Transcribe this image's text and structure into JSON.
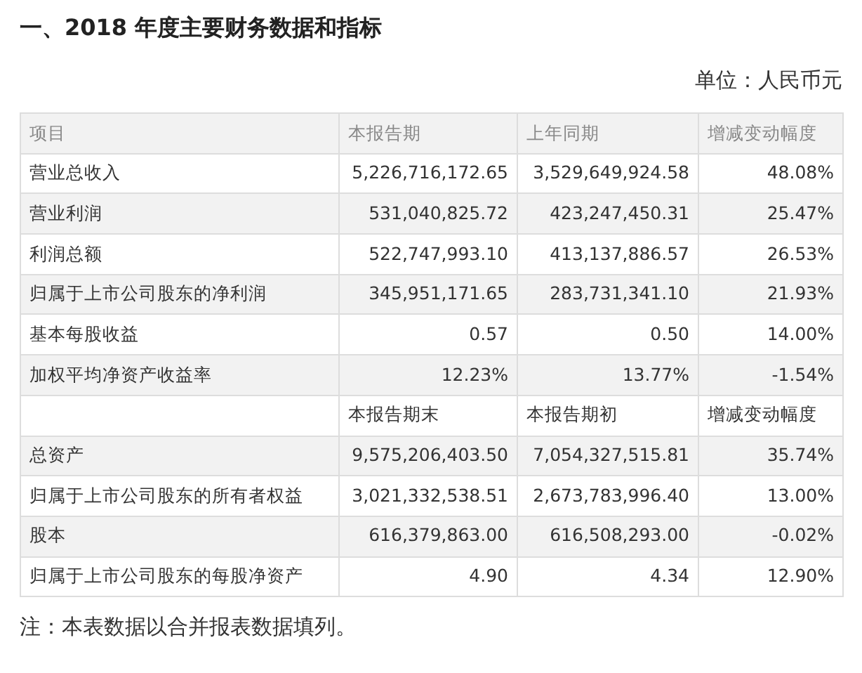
{
  "title": "一、2018 年度主要财务数据和指标",
  "unit": "单位：人民币元",
  "table": {
    "rows": [
      {
        "kind": "header",
        "cells": [
          "项目",
          "本报告期",
          "上年同期",
          "增减变动幅度"
        ]
      },
      {
        "kind": "data",
        "cells": [
          "营业总收入",
          "5,226,716,172.65",
          "3,529,649,924.58",
          "48.08%"
        ]
      },
      {
        "kind": "data",
        "cells": [
          "营业利润",
          "531,040,825.72",
          "423,247,450.31",
          "25.47%"
        ]
      },
      {
        "kind": "data",
        "cells": [
          "利润总额",
          "522,747,993.10",
          "413,137,886.57",
          "26.53%"
        ]
      },
      {
        "kind": "data",
        "cells": [
          "归属于上市公司股东的净利润",
          "345,951,171.65",
          "283,731,341.10",
          "21.93%"
        ]
      },
      {
        "kind": "data",
        "cells": [
          "基本每股收益",
          "0.57",
          "0.50",
          "14.00%"
        ]
      },
      {
        "kind": "data",
        "cells": [
          "加权平均净资产收益率",
          "12.23%",
          "13.77%",
          "-1.54%"
        ]
      },
      {
        "kind": "subheader",
        "cells": [
          "",
          "本报告期末",
          "本报告期初",
          "增减变动幅度"
        ]
      },
      {
        "kind": "data",
        "cells": [
          "总资产",
          "9,575,206,403.50",
          "7,054,327,515.81",
          "35.74%"
        ]
      },
      {
        "kind": "data",
        "cells": [
          "归属于上市公司股东的所有者权益",
          "3,021,332,538.51",
          "2,673,783,996.40",
          "13.00%"
        ]
      },
      {
        "kind": "data",
        "cells": [
          "股本",
          "616,379,863.00",
          "616,508,293.00",
          "-0.02%"
        ]
      },
      {
        "kind": "data",
        "cells": [
          "归属于上市公司股东的每股净资产",
          "4.90",
          "4.34",
          "12.90%"
        ]
      }
    ]
  },
  "note": "注：本表数据以合并报表数据填列。"
}
